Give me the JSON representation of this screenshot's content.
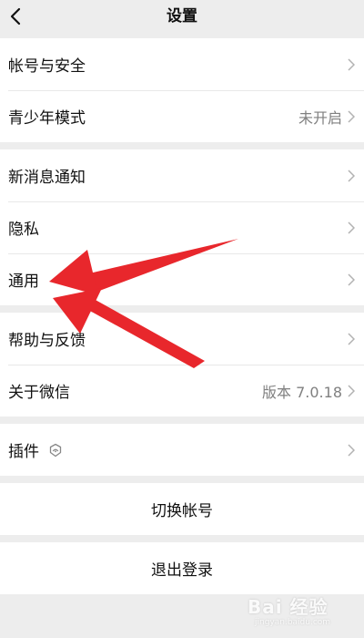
{
  "nav": {
    "title": "设置"
  },
  "groups": [
    [
      {
        "label": "帐号与安全",
        "value": ""
      },
      {
        "label": "青少年模式",
        "value": "未开启"
      }
    ],
    [
      {
        "label": "新消息通知",
        "value": ""
      },
      {
        "label": "隐私",
        "value": ""
      },
      {
        "label": "通用",
        "value": ""
      }
    ],
    [
      {
        "label": "帮助与反馈",
        "value": ""
      },
      {
        "label": "关于微信",
        "value": "版本 7.0.18"
      }
    ],
    [
      {
        "label": "插件",
        "value": ""
      }
    ]
  ],
  "actions": {
    "switch_account": "切换帐号",
    "logout": "退出登录"
  },
  "watermark": {
    "text": "Bai 经验",
    "sub": "jingyan.baidu.com"
  },
  "colors": {
    "background": "#ededed",
    "annotation_arrow": "#e8272c"
  },
  "icons": {
    "back": "chevron-left-icon",
    "row_arrow": "chevron-right-icon",
    "plugin": "plugin-icon"
  }
}
